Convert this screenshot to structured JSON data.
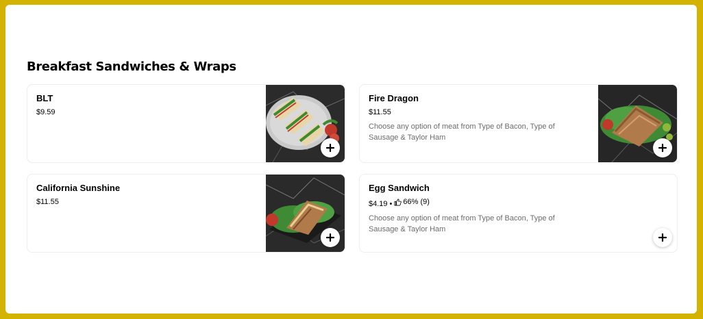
{
  "section": {
    "title": "Breakfast Sandwiches & Wraps"
  },
  "items": [
    {
      "name": "BLT",
      "price": "$9.59",
      "add_icon": "plus-icon",
      "image": "club-sandwich-photo"
    },
    {
      "name": "Fire Dragon",
      "price": "$11.55",
      "description": "Choose any option of meat from Type of Bacon, Type of Sausage & Taylor Ham",
      "add_icon": "plus-icon",
      "image": "wrap-photo"
    },
    {
      "name": "California Sunshine",
      "price": "$11.55",
      "add_icon": "plus-icon",
      "image": "wrap-photo"
    },
    {
      "name": "Egg Sandwich",
      "price": "$4.19",
      "separator": "•",
      "rating": "66% (9)",
      "rating_icon": "thumbs-up-icon",
      "description": "Choose any option of meat from Type of Bacon, Type of Sausage & Taylor Ham",
      "add_icon": "plus-icon"
    }
  ],
  "colors": {
    "frame": "#d4b200",
    "card_border": "#eeeeee",
    "description_text": "#6b6b6b"
  }
}
